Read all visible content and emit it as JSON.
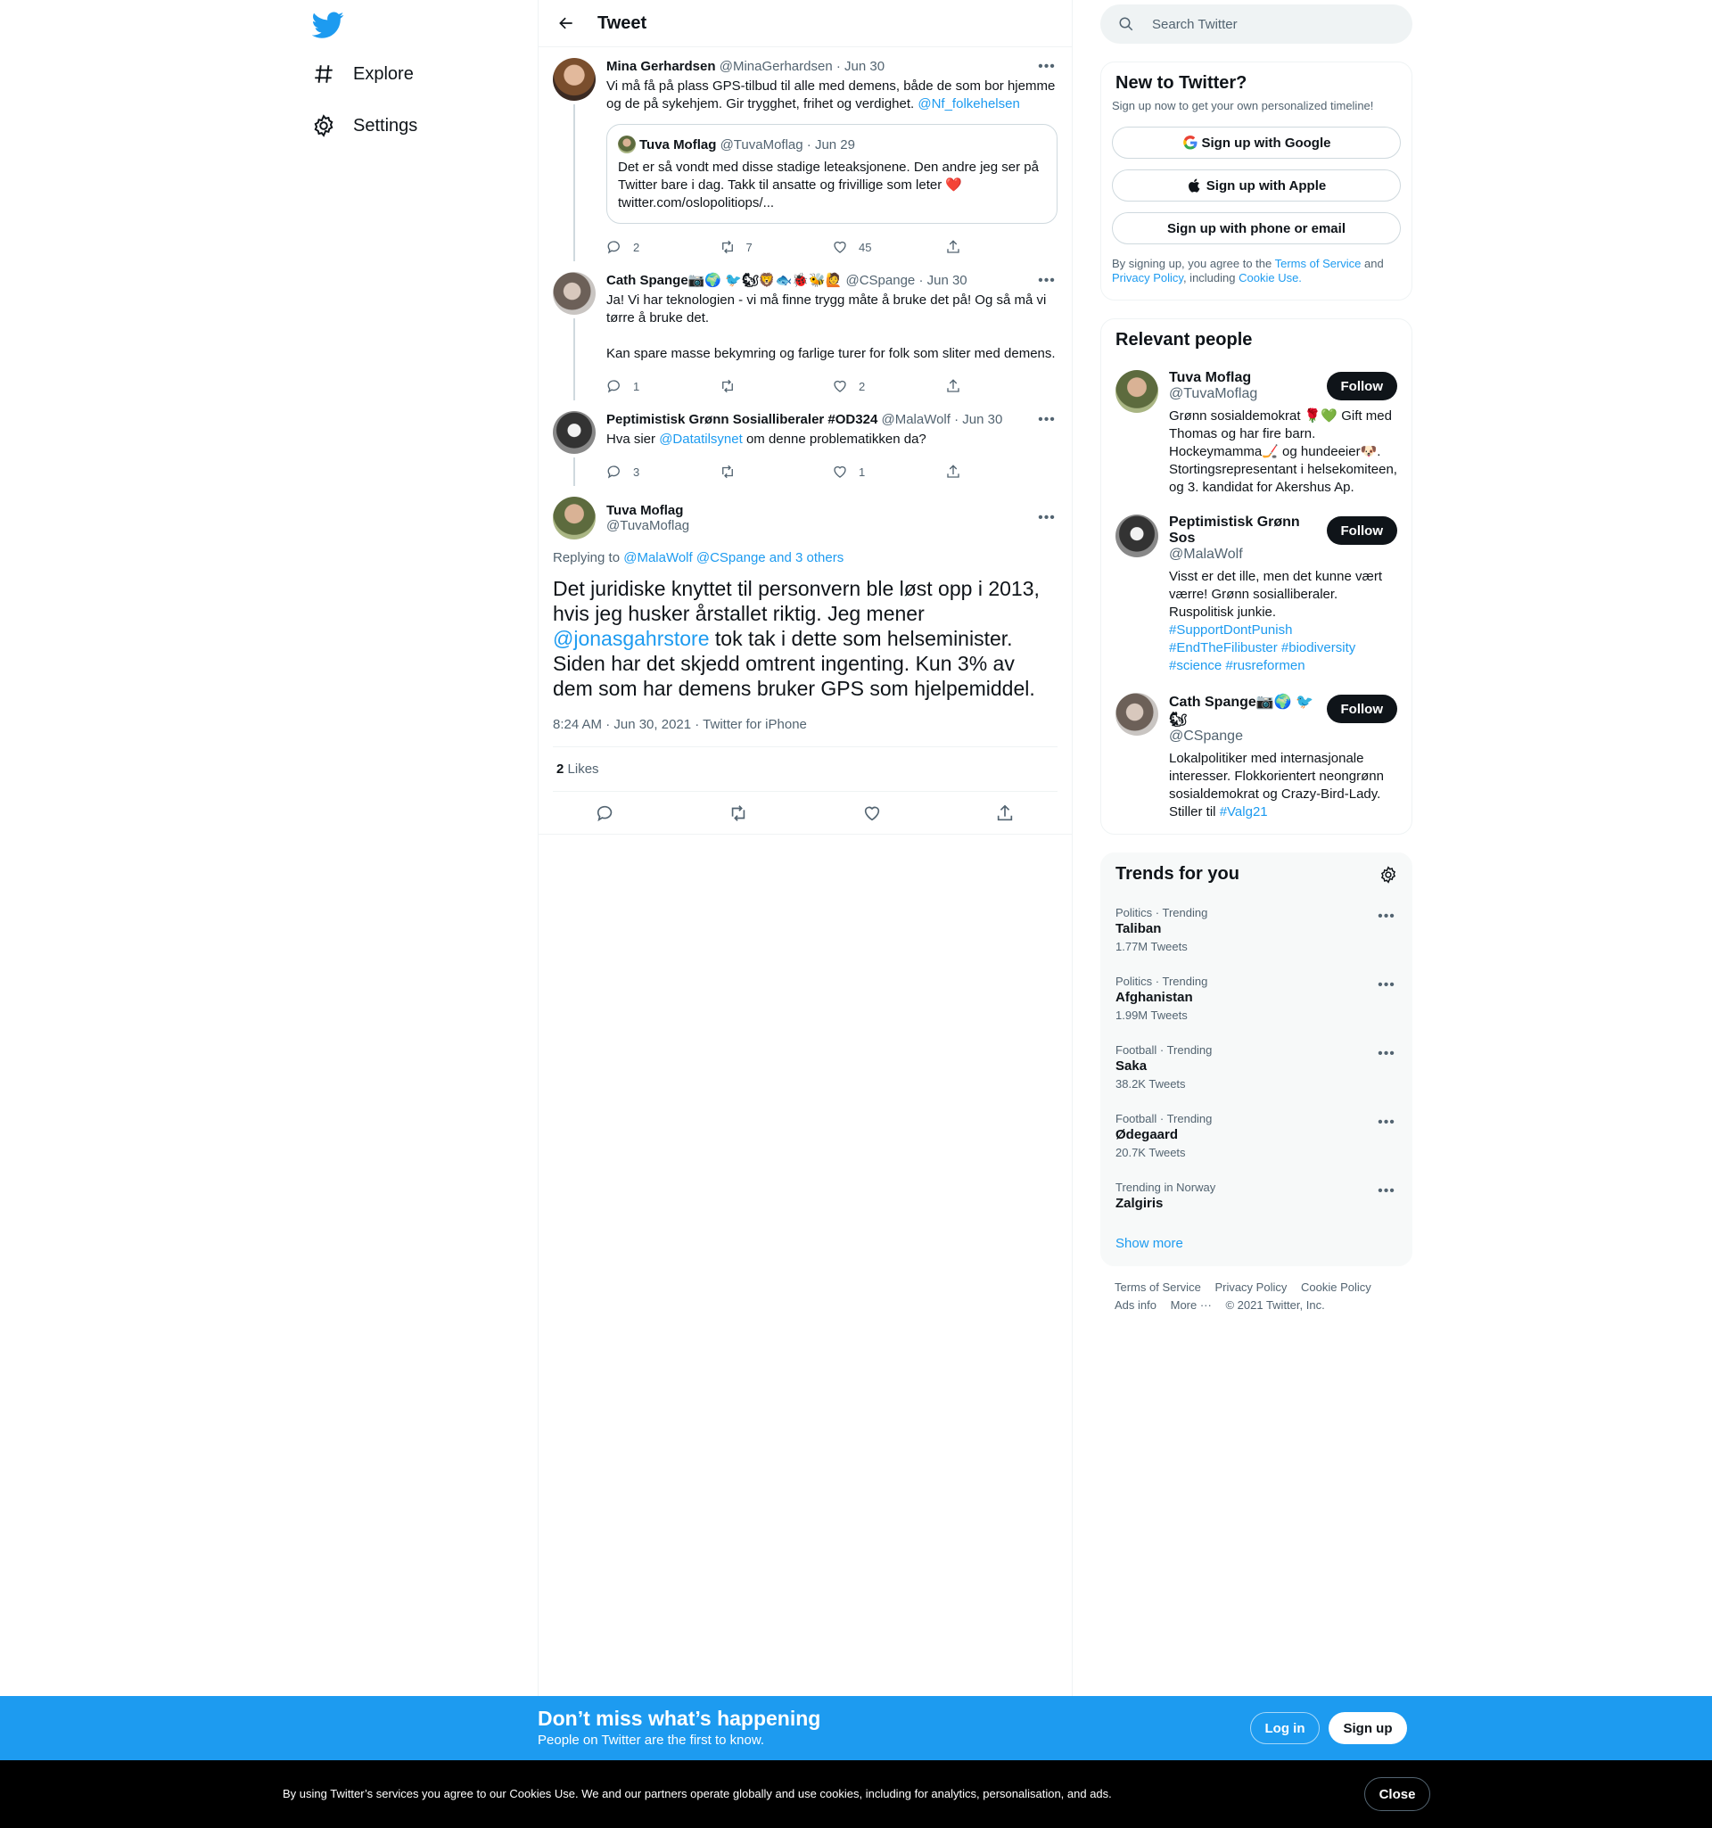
{
  "colors": {
    "accent": "#1d9bf0",
    "text": "#0f1419",
    "muted": "#536471",
    "border": "#eff3f4",
    "like_heart": "#f91880"
  },
  "nav": {
    "logo": "twitter-bird-icon",
    "items": [
      {
        "label": "Explore",
        "icon": "hashtag-icon"
      },
      {
        "label": "Settings",
        "icon": "gear-icon"
      }
    ]
  },
  "header": {
    "title": "Tweet"
  },
  "thread": [
    {
      "name": "Mina Gerhardsen",
      "handle": "@MinaGerhardsen",
      "date": "· Jun 30",
      "text": "Vi må få på plass GPS-tilbud til alle med demens, både de som bor hjemme og de på sykehjem. Gir trygghet, frihet og verdighet. ",
      "mention": "@Nf_folkehelsen",
      "quote": {
        "name": "Tuva Moflag",
        "handle": "@TuvaMoflag",
        "date": "· Jun 29",
        "text": "Det er så vondt med disse stadige leteaksjonene. Den andre jeg ser på Twitter bare i dag. Takk til ansatte og frivillige som leter ❤️ twitter.com/oslopolitiops/..."
      },
      "replies": "2",
      "retweets": "7",
      "likes": "45"
    },
    {
      "name": "Cath Spange📷🌍 🐦🐿🦁🐟🐞🐝🙋",
      "handle": "@CSpange",
      "date": "· Jun 30",
      "text": "Ja! Vi har teknologien - vi må finne trygg måte å bruke det på! Og så må vi tørre å bruke det.\n\nKan spare masse bekymring og farlige turer for folk som sliter med demens.",
      "replies": "1",
      "retweets": "",
      "likes": "2"
    },
    {
      "name": "Peptimistisk Grønn Sosialliberaler #OD324",
      "handle": "@MalaWolf",
      "date": "· Jun 30",
      "text_before": "Hva sier ",
      "mention": "@Datatilsynet",
      "text_after": " om denne problematikken da?",
      "replies": "3",
      "retweets": "",
      "likes": "1"
    }
  ],
  "focal": {
    "name": "Tuva Moflag",
    "handle": "@TuvaMoflag",
    "replying_prefix": "Replying to ",
    "replying_to": "@MalaWolf @CSpange and 3 others",
    "text_before": "Det juridiske knyttet til personvern ble løst opp i 2013, hvis jeg husker årstallet riktig. Jeg mener ",
    "mention": "@jonasgahrstore",
    "text_after": " tok tak i dette som helseminister. Siden har det skjedd omtrent ingenting. Kun 3% av dem som har demens bruker GPS som hjelpemiddel.",
    "meta": "8:24 AM · Jun 30, 2021 · Twitter for iPhone",
    "likes_count": "2",
    "likes_label": "Likes"
  },
  "search": {
    "placeholder": "Search Twitter"
  },
  "signup": {
    "title": "New to Twitter?",
    "subtitle": "Sign up now to get your own personalized timeline!",
    "google": "Sign up with Google",
    "apple": "Sign up with Apple",
    "phone": "Sign up with phone or email",
    "legal_1": "By signing up, you agree to the ",
    "terms": "Terms of Service",
    "legal_2": " and ",
    "privacy": "Privacy Policy",
    "legal_3": ", including ",
    "cookie": "Cookie Use."
  },
  "relevant": {
    "title": "Relevant people",
    "follow_label": "Follow",
    "people": [
      {
        "name": "Tuva Moflag",
        "handle": "@TuvaMoflag",
        "bio": "Grønn sosialdemokrat 🌹💚 Gift med Thomas og har fire barn. Hockeymamma🏒 og hundeeier🐶. Stortingsrepresentant i helsekomiteen, og 3. kandidat for Akershus Ap.",
        "tags": ""
      },
      {
        "name": "Peptimistisk Grønn Sos",
        "handle": "@MalaWolf",
        "bio": "Visst er det ille, men det kunne vært værre! Grønn sosialliberaler. Ruspolitisk junkie.",
        "tags": "#SupportDontPunish #EndTheFilibuster #biodiversity #science #rusreformen"
      },
      {
        "name": "Cath Spange📷🌍 🐦🐿",
        "handle": "@CSpange",
        "bio": "Lokalpolitiker med internasjonale interesser. Flokkorientert neongrønn sosialdemokrat og Crazy-Bird-Lady. Stiller til ",
        "tags": "#Valg21"
      }
    ]
  },
  "trends": {
    "title": "Trends for you",
    "items": [
      {
        "meta": "Politics · Trending",
        "name": "Taliban",
        "count": "1.77M Tweets"
      },
      {
        "meta": "Politics · Trending",
        "name": "Afghanistan",
        "count": "1.99M Tweets"
      },
      {
        "meta": "Football · Trending",
        "name": "Saka",
        "count": "38.2K Tweets"
      },
      {
        "meta": "Football · Trending",
        "name": "Ødegaard",
        "count": "20.7K Tweets"
      },
      {
        "meta": "Trending in Norway",
        "name": "Zalgiris",
        "count": ""
      }
    ],
    "show_more": "Show more"
  },
  "footer": {
    "terms": "Terms of Service",
    "privacy": "Privacy Policy",
    "cookie": "Cookie Policy",
    "ads": "Ads info",
    "more": "More ···",
    "copyright": "© 2021 Twitter, Inc."
  },
  "promo": {
    "title": "Don’t miss what’s happening",
    "subtitle": "People on Twitter are the first to know.",
    "login": "Log in",
    "signup": "Sign up"
  },
  "cookie_bar": {
    "text": "By using Twitter’s services you agree to our Cookies Use. We and our partners operate globally and use cookies, including for analytics, personalisation, and ads.",
    "close": "Close"
  }
}
